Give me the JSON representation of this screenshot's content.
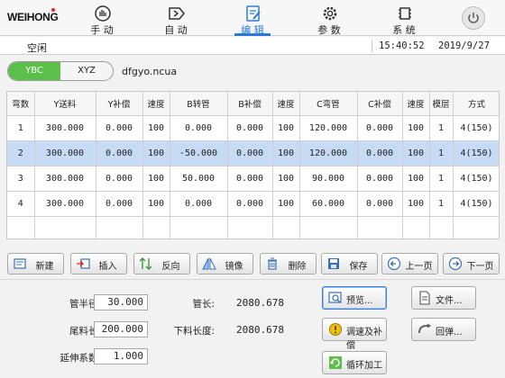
{
  "brand": {
    "logo_text": "WEIHONG"
  },
  "nav": {
    "items": [
      {
        "label": "手 动",
        "icon": "hand-icon"
      },
      {
        "label": "自 动",
        "icon": "auto-run-icon"
      },
      {
        "label": "编 辑",
        "icon": "edit-icon",
        "active": true
      },
      {
        "label": "参 数",
        "icon": "gear-icon"
      },
      {
        "label": "系 统",
        "icon": "chip-icon"
      }
    ]
  },
  "status": {
    "state": "空闲",
    "time": "15:40:52",
    "date": "2019/9/27"
  },
  "mode": {
    "on_label": "YBC",
    "off_label": "XYZ",
    "filename": "dfgyo.ncua"
  },
  "table": {
    "headers": [
      "弯数",
      "Y送料",
      "Y补偿",
      "速度",
      "B转管",
      "B补偿",
      "速度",
      "C弯管",
      "C补偿",
      "速度",
      "模层",
      "方式"
    ],
    "rows": [
      [
        "1",
        "300.000",
        "0.000",
        "100",
        "0.000",
        "0.000",
        "100",
        "120.000",
        "0.000",
        "100",
        "1",
        "4(150)"
      ],
      [
        "2",
        "300.000",
        "0.000",
        "100",
        "-50.000",
        "0.000",
        "100",
        "120.000",
        "0.000",
        "100",
        "1",
        "4(150)"
      ],
      [
        "3",
        "300.000",
        "0.000",
        "100",
        "50.000",
        "0.000",
        "100",
        "90.000",
        "0.000",
        "100",
        "1",
        "4(150)"
      ],
      [
        "4",
        "300.000",
        "0.000",
        "100",
        "0.000",
        "0.000",
        "100",
        "60.000",
        "0.000",
        "100",
        "1",
        "4(150)"
      ]
    ],
    "selected_row": 2
  },
  "actions": {
    "new": "新建",
    "insert": "插入",
    "reverse": "反向",
    "mirror": "镜像",
    "delete": "删除",
    "save": "保存",
    "prev_page": "上一页",
    "next_page": "下一页"
  },
  "params": {
    "radius_label": "管半径:",
    "radius": "30.000",
    "tail_label": "尾料长:",
    "tail": "200.000",
    "stretch_label": "延伸系数:",
    "stretch": "1.000",
    "length_label": "管长:",
    "length": "2080.678",
    "cut_label": "下料长度:",
    "cut": "2080.678"
  },
  "tools": {
    "preview": "预览...",
    "file": "文件...",
    "speed_comp": "调速及补偿",
    "rebound": "回弹...",
    "loop": "循环加工"
  },
  "colors": {
    "accent": "#2a7ad4",
    "toggle_on": "#5bbf4a",
    "selected_row": "#c8dbf5"
  }
}
